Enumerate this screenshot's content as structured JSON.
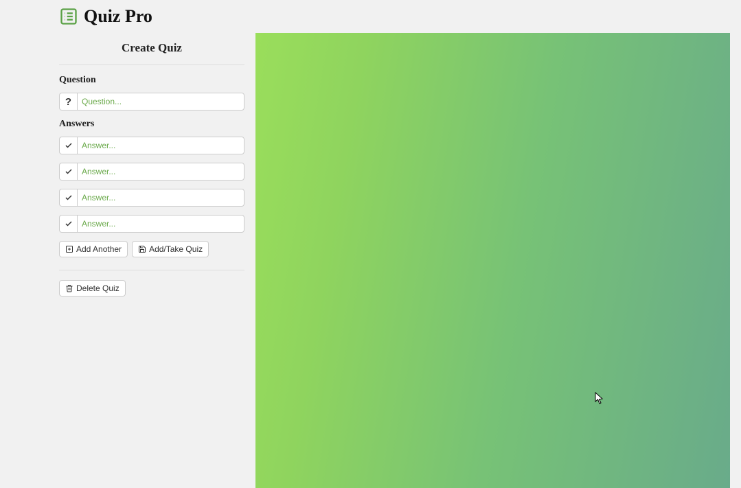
{
  "header": {
    "title": "Quiz Pro"
  },
  "sidebar": {
    "heading": "Create Quiz",
    "question_label": "Question",
    "question_placeholder": "Question...",
    "answers_label": "Answers",
    "answer_placeholders": [
      "Answer...",
      "Answer...",
      "Answer...",
      "Answer..."
    ],
    "add_another_label": "Add Another",
    "add_take_quiz_label": "Add/Take Quiz",
    "delete_quiz_label": "Delete Quiz"
  }
}
